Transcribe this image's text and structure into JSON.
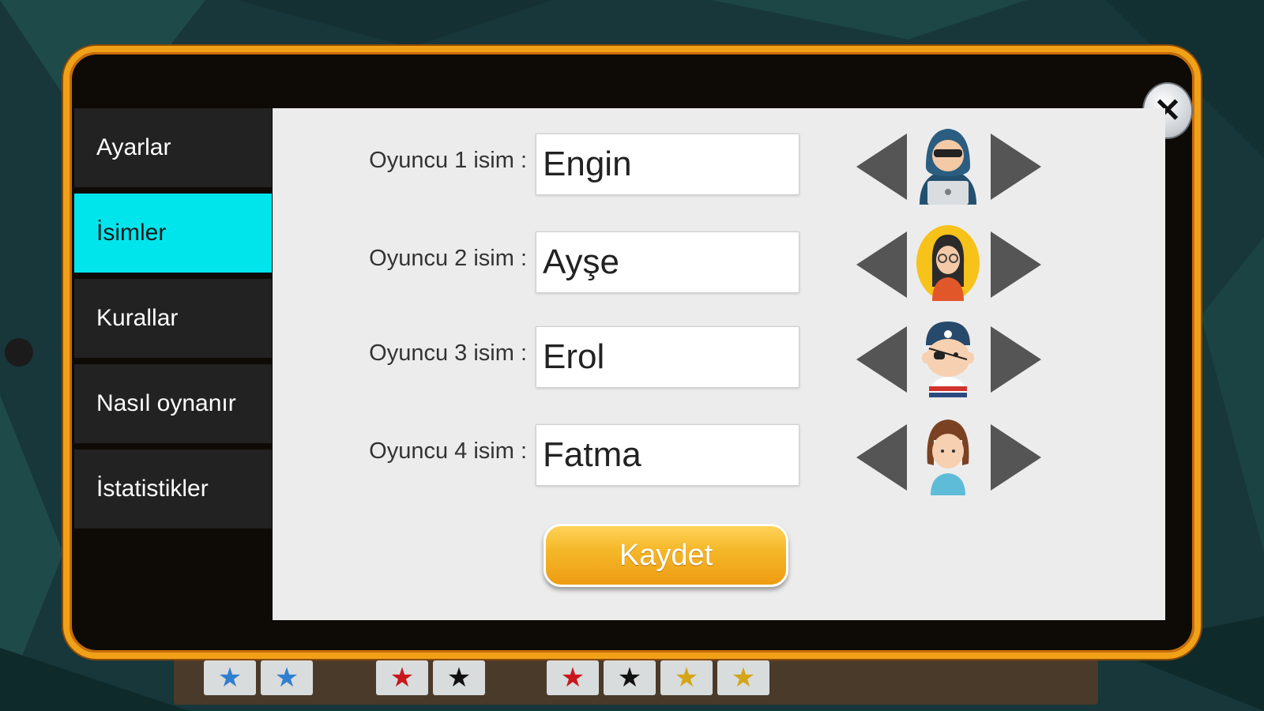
{
  "sidebar": {
    "items": [
      {
        "label": "Ayarlar",
        "active": false
      },
      {
        "label": "İsimler",
        "active": true
      },
      {
        "label": "Kurallar",
        "active": false
      },
      {
        "label": "Nasıl oynanır",
        "active": false
      },
      {
        "label": "İstatistikler",
        "active": false
      }
    ]
  },
  "players": [
    {
      "label": "Oyuncu 1 isim :",
      "name": "Engin",
      "avatar": "hacker-avatar-icon"
    },
    {
      "label": "Oyuncu 2 isim :",
      "name": "Ayşe",
      "avatar": "girl-glasses-avatar-icon"
    },
    {
      "label": "Oyuncu 3 isim :",
      "name": "Erol",
      "avatar": "pirate-boy-avatar-icon"
    },
    {
      "label": "Oyuncu 4 isim :",
      "name": "Fatma",
      "avatar": "girl-avatar-icon"
    }
  ],
  "save_button": {
    "label": "Kaydet"
  },
  "close_button": {
    "label": "✕"
  },
  "colors": {
    "frame": "#f0a117",
    "active_tab": "#00e5ec",
    "save_button": "#f5b82a",
    "panel": "#ececec"
  }
}
